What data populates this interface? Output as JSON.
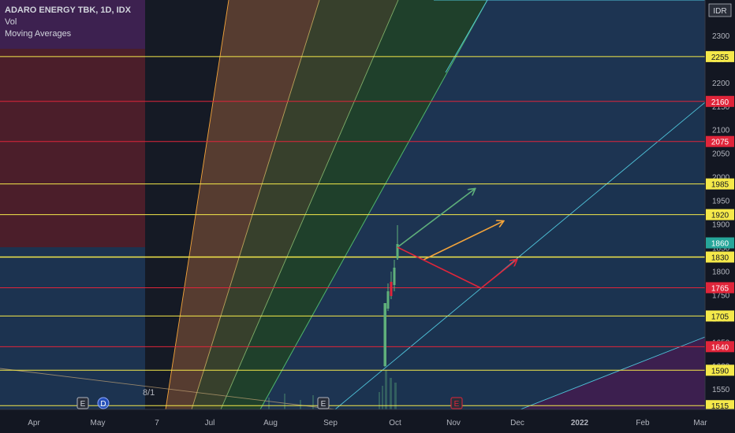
{
  "legend": {
    "symbol": "ADARO ENERGY TBK, 1D, IDX",
    "vol": "Vol",
    "ma": "Moving Averages"
  },
  "colors": {
    "background": "#131722",
    "axis_text": "#b2b5be",
    "yellow": "#f5e94a",
    "red": "#e0253a",
    "green": "#5fb07b",
    "orange": "#f4a43a",
    "cyan": "#4fc3d9",
    "fan_red_zone": "#5a1e2b",
    "fan_blue_zone": "#1f3a5a",
    "fan_purple_zone": "#3c1f4f",
    "fan_orange": "#8a5a3a",
    "fan_olive": "#4d5a2e",
    "fan_green": "#27522f"
  },
  "chart_data": {
    "type": "candlestick",
    "currency_label": "IDR",
    "y_ticks": [
      1550,
      1600,
      1650,
      1700,
      1750,
      1800,
      1850,
      1900,
      1950,
      2000,
      2050,
      2100,
      2150,
      2200,
      2250,
      2300,
      2350
    ],
    "ylim": [
      1507,
      2375
    ],
    "x_ticks": [
      "Apr",
      "May",
      "7",
      "Jul",
      "Aug",
      "Sep",
      "Oct",
      "Nov",
      "Dec",
      "2022",
      "Feb",
      "Mar"
    ],
    "bold_x_ticks": [
      "2022"
    ],
    "current_price": 1860,
    "horizontal_levels": [
      {
        "value": 2255,
        "color": "yellow",
        "label": "2255"
      },
      {
        "value": 2160,
        "color": "red",
        "label": "2160"
      },
      {
        "value": 2075,
        "color": "red",
        "label": "2075"
      },
      {
        "value": 1985,
        "color": "yellow",
        "label": "1985"
      },
      {
        "value": 1920,
        "color": "yellow",
        "label": "1920"
      },
      {
        "value": 1830,
        "color": "yellow",
        "label": "1830"
      },
      {
        "value": 1765,
        "color": "red",
        "label": "1765"
      },
      {
        "value": 1705,
        "color": "yellow",
        "label": "1705"
      },
      {
        "value": 1640,
        "color": "red",
        "label": "1640"
      },
      {
        "value": 1590,
        "color": "yellow",
        "label": "1590"
      },
      {
        "value": 1515,
        "color": "yellow",
        "label": "1515"
      }
    ],
    "event_markers": [
      {
        "label": "E",
        "type": "earnings"
      },
      {
        "label": "D",
        "type": "dividend"
      },
      {
        "label": "E",
        "type": "earnings"
      },
      {
        "label": "E",
        "type": "earnings_upcoming"
      }
    ],
    "annotation": "8/1"
  }
}
